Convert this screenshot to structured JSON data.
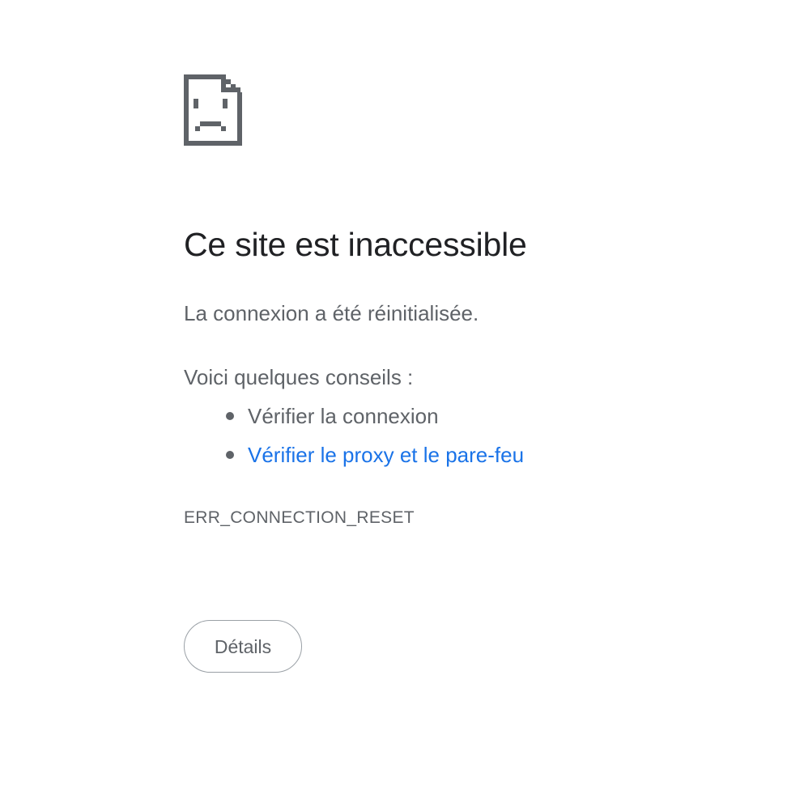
{
  "error_page": {
    "icon": "sad-document-icon",
    "title": "Ce site est inaccessible",
    "subtitle": "La connexion a été réinitialisée.",
    "suggestions_heading": "Voici quelques conseils :",
    "suggestions": [
      {
        "label": "Vérifier la connexion",
        "is_link": false
      },
      {
        "label": "Vérifier le proxy et le pare-feu",
        "is_link": true
      }
    ],
    "error_code": "ERR_CONNECTION_RESET",
    "details_button_label": "Détails"
  },
  "colors": {
    "title": "#202124",
    "body_text": "#5f6368",
    "link": "#1a73e8",
    "icon": "#5f6368",
    "button_border": "#9aa0a6"
  }
}
